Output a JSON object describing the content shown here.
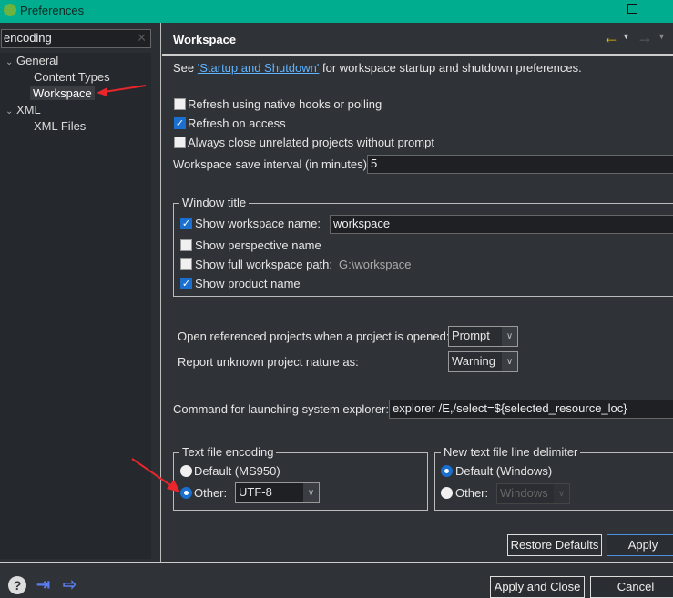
{
  "window": {
    "title": "Preferences",
    "maximize_icon": "maximize-icon",
    "close_icon": "close-icon"
  },
  "sidebar": {
    "search_value": "encoding",
    "items": [
      {
        "label": "General",
        "expanded": true
      },
      {
        "label": "Content Types"
      },
      {
        "label": "Workspace",
        "selected": true
      },
      {
        "label": "XML",
        "expanded": true
      },
      {
        "label": "XML Files"
      }
    ]
  },
  "page": {
    "title": "Workspace",
    "intro_prefix": "See ",
    "intro_link": "'Startup and Shutdown'",
    "intro_suffix": " for workspace startup and shutdown preferences.",
    "options": [
      {
        "label": "Refresh using native hooks or polling",
        "checked": false
      },
      {
        "label": "Refresh on access",
        "checked": true
      },
      {
        "label": "Always close unrelated projects without prompt",
        "checked": false
      }
    ],
    "save_interval_label": "Workspace save interval (in minutes):",
    "save_interval_value": "5",
    "window_title": {
      "legend": "Window title",
      "show_workspace_name": "Show workspace name:",
      "workspace_name_value": "workspace",
      "show_perspective_name": "Show perspective name",
      "show_full_path": "Show full workspace path:",
      "full_path_value": "G:\\workspace",
      "show_product_name": "Show product name",
      "checked": {
        "workspace_name": true,
        "perspective_name": false,
        "full_path": false,
        "product_name": true
      }
    },
    "open_ref_label": "Open referenced projects when a project is opened:",
    "open_ref_value": "Prompt",
    "report_label": "Report unknown project nature as:",
    "report_value": "Warning",
    "explorer_label": "Command for launching system explorer:",
    "explorer_value": "explorer /E,/select=${selected_resource_loc}",
    "encoding": {
      "legend": "Text file encoding",
      "default_label": "Default (MS950)",
      "other_label": "Other:",
      "other_value": "UTF-8",
      "selected": "other"
    },
    "delimiter": {
      "legend": "New text file line delimiter",
      "default_label": "Default (Windows)",
      "other_label": "Other:",
      "other_value": "Windows",
      "selected": "default"
    },
    "restore_defaults": "Restore Defaults",
    "apply": "Apply"
  },
  "footer": {
    "apply_close": "Apply and Close",
    "cancel": "Cancel"
  },
  "colors": {
    "titlebar": "#00ad8e",
    "accent": "#1a6fcf",
    "back_arrow": "#f5c400",
    "annotation_arrow": "#e8262b"
  }
}
